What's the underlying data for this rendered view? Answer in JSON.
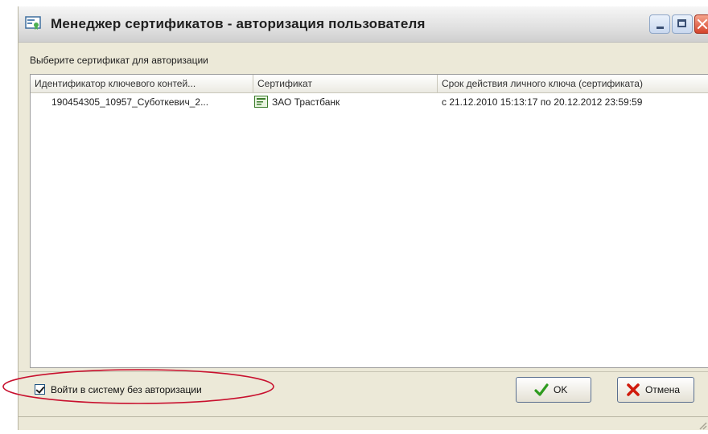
{
  "window": {
    "title": "Менеджер сертификатов - авторизация пользователя",
    "icon": "certificate-window-icon",
    "controls": [
      "minimize-icon",
      "maximize-icon",
      "close-icon"
    ]
  },
  "prompt": "Выберите сертификат для авторизации",
  "list": {
    "columns": [
      "Идентификатор ключевого контей...",
      "Сертификат",
      "Срок действия личного ключа (сертификата)"
    ],
    "rows": [
      {
        "container": "190454305_10957_Суботкевич_2...",
        "certificate": "ЗАО Трастбанк",
        "certificate_icon": "certificate-icon",
        "validity": "с 21.12.2010 15:13:17 по 20.12.2012 23:59:59"
      }
    ]
  },
  "options": {
    "no_auth_label": "Войти в систему без авторизации",
    "no_auth_checked": true
  },
  "buttons": {
    "ok_label": "OK",
    "ok_icon": "checkmark-icon",
    "cancel_label": "Отмена",
    "cancel_icon": "cross-icon"
  },
  "colors": {
    "window_bg": "#ece9d8",
    "highlight": "#c8102e",
    "ok_icon": "#2e9b1f",
    "cancel_icon": "#d01a0c"
  }
}
